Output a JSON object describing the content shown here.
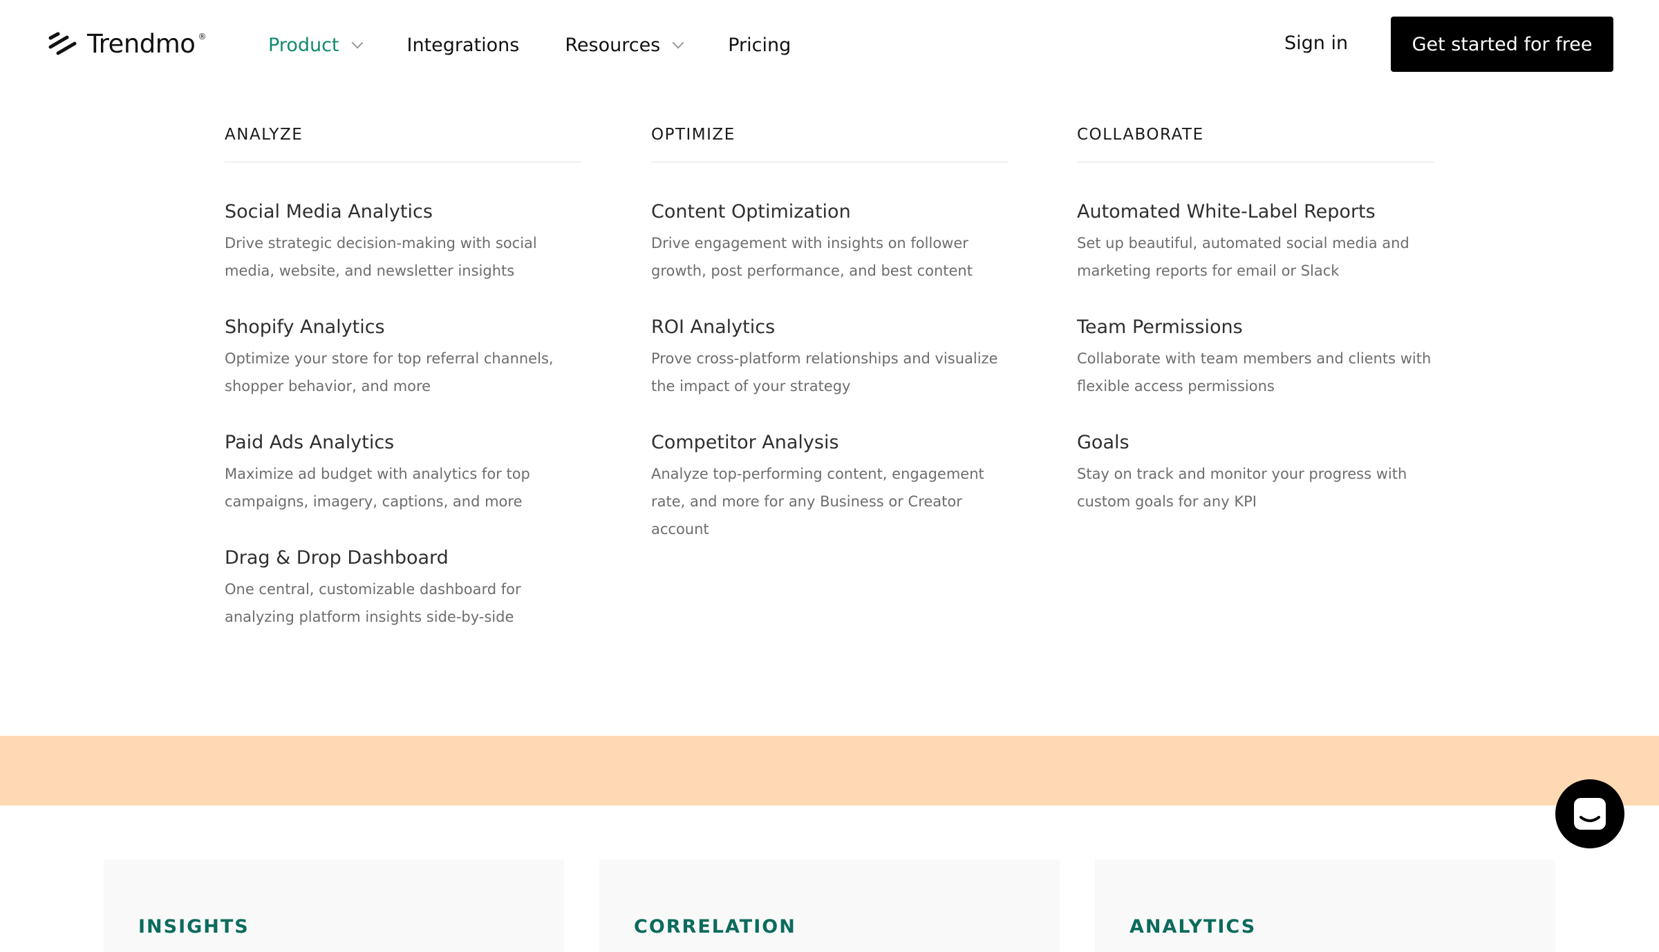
{
  "header": {
    "brand": "Trendmo",
    "brand_mark": "®",
    "nav": [
      {
        "label": "Product",
        "active": true,
        "has_dropdown": true
      },
      {
        "label": "Integrations",
        "active": false,
        "has_dropdown": false
      },
      {
        "label": "Resources",
        "active": false,
        "has_dropdown": true
      },
      {
        "label": "Pricing",
        "active": false,
        "has_dropdown": false
      }
    ],
    "sign_in": "Sign in",
    "cta": "Get started for free"
  },
  "menu": {
    "columns": [
      {
        "heading": "ANALYZE",
        "items": [
          {
            "title": "Social Media Analytics",
            "desc": "Drive strategic decision-making with social media, website, and newsletter insights"
          },
          {
            "title": "Shopify Analytics",
            "desc": "Optimize your store for top referral channels, shopper behavior, and more"
          },
          {
            "title": "Paid Ads Analytics",
            "desc": "Maximize ad budget with analytics for top campaigns, imagery, captions, and more"
          },
          {
            "title": "Drag & Drop Dashboard",
            "desc": "One central, customizable dashboard for analyzing platform insights side-by-side"
          }
        ]
      },
      {
        "heading": "OPTIMIZE",
        "items": [
          {
            "title": "Content Optimization",
            "desc": "Drive engagement with insights on follower growth, post performance, and best content"
          },
          {
            "title": "ROI Analytics",
            "desc": "Prove cross-platform relationships and visualize the impact of your strategy"
          },
          {
            "title": "Competitor Analysis",
            "desc": "Analyze top-performing content, engagement rate, and more for any Business or Creator account"
          }
        ]
      },
      {
        "heading": "COLLABORATE",
        "items": [
          {
            "title": "Automated White-Label Reports",
            "desc": "Set up beautiful, automated social media and marketing reports for email or Slack"
          },
          {
            "title": "Team Permissions",
            "desc": "Collaborate with team members and clients with flexible access permissions"
          },
          {
            "title": "Goals",
            "desc": "Stay on track and monitor your progress with custom goals for any KPI"
          }
        ]
      }
    ]
  },
  "cards": [
    {
      "label": "INSIGHTS"
    },
    {
      "label": "CORRELATION"
    },
    {
      "label": "ANALYTICS"
    }
  ],
  "colors": {
    "accent": "#0f8a6e",
    "band": "#ffd9b3",
    "card_label": "#0b6b5c",
    "cta_bg": "#000000"
  },
  "icons": {
    "logo": "trendmo-logo-icon",
    "chevron": "chevron-down-icon",
    "chat": "chat-icon"
  }
}
